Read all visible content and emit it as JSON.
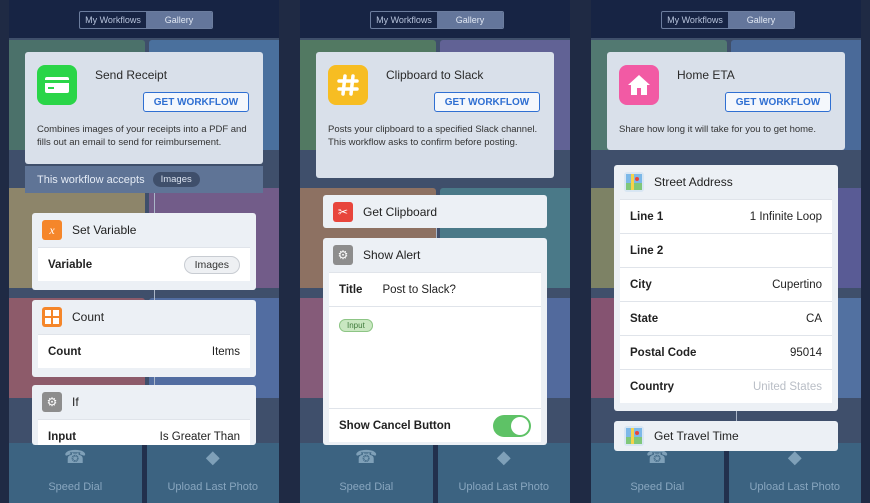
{
  "segment": {
    "my_workflows": "My Workflows",
    "gallery": "Gallery"
  },
  "bottom_tiles": {
    "speed_dial": "Speed Dial",
    "upload_last_photo": "Upload Last Photo"
  },
  "colors": {
    "accent": "#2f6fd2",
    "receipt_green": "#2ad548",
    "slack_yellow": "#f7bd22",
    "home_pink": "#f25aa4",
    "toggle_green": "#5ec266"
  },
  "screen1": {
    "title": "Send Receipt",
    "icon": "credit-card-icon",
    "get_button": "GET WORKFLOW",
    "description": "Combines images of your receipts into a PDF and fills out an email to send for reimbursement.",
    "accepts_label": "This workflow accepts",
    "accepts_value": "Images",
    "actions": [
      {
        "title": "Set Variable",
        "icon": "variable-icon",
        "row_label": "Variable",
        "row_value": "Images"
      },
      {
        "title": "Count",
        "icon": "calculator-icon",
        "row_label": "Count",
        "row_value": "Items"
      },
      {
        "title": "If",
        "icon": "gear-icon",
        "row_label": "Input",
        "row_value": "Is Greater Than"
      }
    ]
  },
  "screen2": {
    "title": "Clipboard to Slack",
    "icon": "slack-hash-icon",
    "get_button": "GET WORKFLOW",
    "description": "Posts your clipboard to a specified Slack channel. This workflow asks to confirm before posting.",
    "actions": [
      {
        "title": "Get Clipboard",
        "icon": "scissors-icon"
      },
      {
        "title": "Show Alert",
        "icon": "gear-icon",
        "title_label": "Title",
        "title_value": "Post to Slack?",
        "input_tag": "Input",
        "cancel_label": "Show Cancel Button",
        "cancel_on": true
      }
    ]
  },
  "screen3": {
    "title": "Home ETA",
    "icon": "house-icon",
    "get_button": "GET WORKFLOW",
    "description": "Share how long it will take for you to get home.",
    "address": {
      "title": "Street Address",
      "icon": "map-icon",
      "rows": [
        {
          "label": "Line 1",
          "value": "1 Infinite Loop"
        },
        {
          "label": "Line 2",
          "value": ""
        },
        {
          "label": "City",
          "value": "Cupertino"
        },
        {
          "label": "State",
          "value": "CA"
        },
        {
          "label": "Postal Code",
          "value": "95014"
        },
        {
          "label": "Country",
          "value": "United States"
        }
      ]
    },
    "travel": {
      "title": "Get Travel Time",
      "icon": "map-icon"
    }
  }
}
